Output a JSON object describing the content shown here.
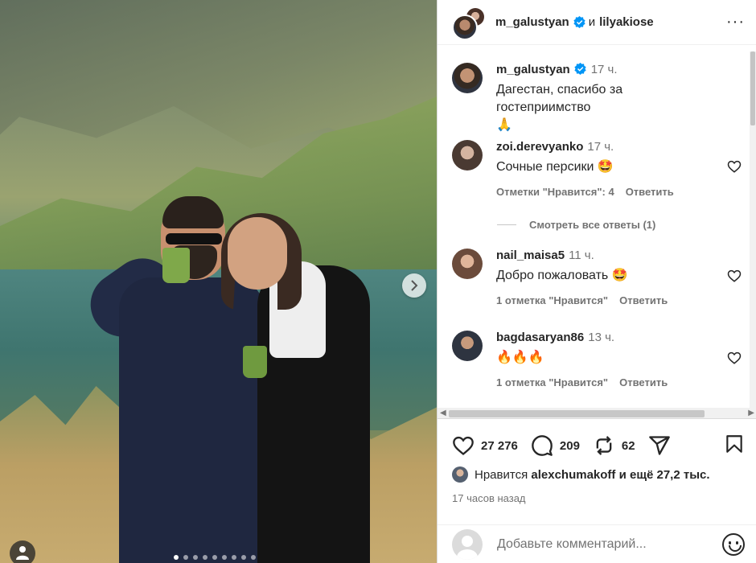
{
  "post": {
    "author": "m_galustyan",
    "and_word": "и",
    "coauthor": "lilyakiose",
    "more_label": "···"
  },
  "caption": {
    "username": "m_galustyan",
    "time": "17 ч.",
    "text": "Дагестан, спасибо за гостеприимство",
    "emoji": "🙏"
  },
  "comments": [
    {
      "username": "zoi.derevyanko",
      "time": "17 ч.",
      "text": "Сочные персики 🤩",
      "likes": "Отметки \"Нравится\": 4",
      "reply": "Ответить",
      "avatar_color": "#5a4a40"
    },
    {
      "username": "nail_maisa5",
      "time": "11 ч.",
      "text": "Добро пожаловать 🤩",
      "likes": "1 отметка \"Нравится\"",
      "reply": "Ответить",
      "avatar_color": "#7a5a4a"
    },
    {
      "username": "bagdasaryan86",
      "time": "13 ч.",
      "text": "🔥🔥🔥",
      "likes": "1 отметка \"Нравится\"",
      "reply": "Ответить",
      "avatar_color": "#3a3f4a"
    }
  ],
  "view_replies": "Смотреть все ответы (1)",
  "actions": {
    "likes_count": "27 276",
    "comments_count": "209",
    "reposts_count": "62"
  },
  "liked_by": {
    "prefix": "Нравится",
    "user": "alexchumakoff",
    "suffix": "и ещё 27,2 тыс."
  },
  "posted_ago": "17 часов назад",
  "add_comment_placeholder": "Добавьте комментарий...",
  "carousel": {
    "total": 9,
    "active": 1
  },
  "colors": {
    "verified": "#0095f6",
    "text": "#262626",
    "muted": "#737373"
  }
}
